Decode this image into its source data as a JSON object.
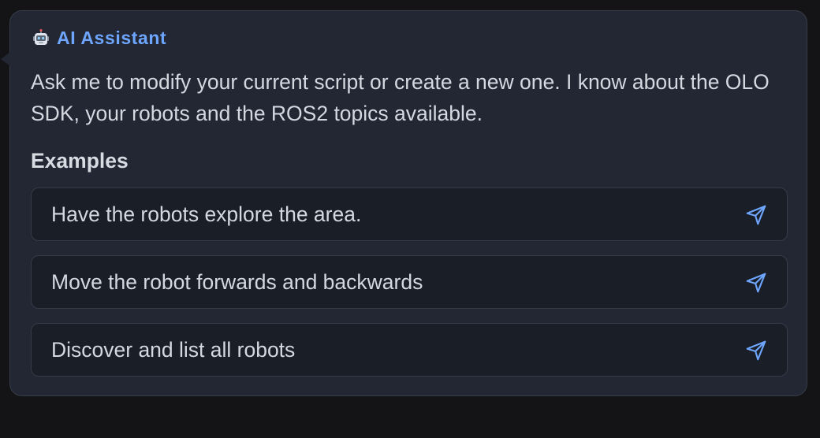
{
  "assistant": {
    "title": "AI Assistant",
    "intro": "Ask me to modify your current script or create a new one. I know about the OLO SDK, your robots and the ROS2 topics available.",
    "icon": "robot-icon",
    "accent_color": "#6ea6ff"
  },
  "examples": {
    "heading": "Examples",
    "items": [
      {
        "label": "Have the robots explore the area.",
        "icon": "send-icon"
      },
      {
        "label": "Move the robot forwards and backwards",
        "icon": "send-icon"
      },
      {
        "label": "Discover and list all robots",
        "icon": "send-icon"
      }
    ]
  }
}
